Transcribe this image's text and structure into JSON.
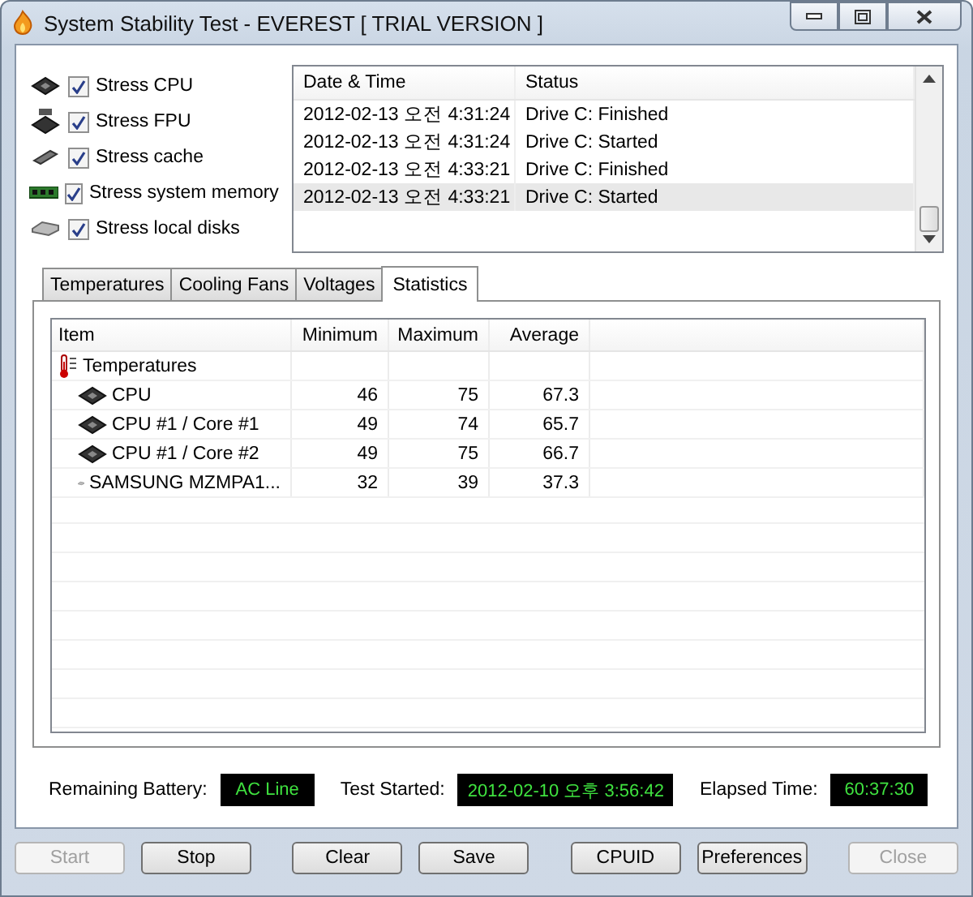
{
  "window": {
    "title": "System Stability Test - EVEREST  [ TRIAL VERSION ]"
  },
  "stress_options": [
    {
      "label": "Stress CPU",
      "checked": true,
      "kind": "cpu"
    },
    {
      "label": "Stress FPU",
      "checked": true,
      "kind": "fpu"
    },
    {
      "label": "Stress cache",
      "checked": true,
      "kind": "cache"
    },
    {
      "label": "Stress system memory",
      "checked": true,
      "kind": "memory"
    },
    {
      "label": "Stress local disks",
      "checked": true,
      "kind": "disk"
    }
  ],
  "log": {
    "columns": [
      "Date & Time",
      "Status"
    ],
    "rows": [
      {
        "date_time": "2012-02-13 오전 4:31:24",
        "status": "Drive C: Finished",
        "selected": false
      },
      {
        "date_time": "2012-02-13 오전 4:31:24",
        "status": "Drive C: Started",
        "selected": false
      },
      {
        "date_time": "2012-02-13 오전 4:33:21",
        "status": "Drive C: Finished",
        "selected": false
      },
      {
        "date_time": "2012-02-13 오전 4:33:21",
        "status": "Drive C: Started",
        "selected": true
      }
    ]
  },
  "tabs": [
    {
      "label": "Temperatures",
      "selected": false
    },
    {
      "label": "Cooling Fans",
      "selected": false
    },
    {
      "label": "Voltages",
      "selected": false
    },
    {
      "label": "Statistics",
      "selected": true
    }
  ],
  "statistics": {
    "columns": [
      "Item",
      "Minimum",
      "Maximum",
      "Average"
    ],
    "rows": [
      {
        "item": "Temperatures",
        "kind": "temperature",
        "children": [
          {
            "item": "CPU",
            "kind": "cpu",
            "minimum": "46",
            "maximum": "75",
            "average": "67.3"
          },
          {
            "item": "CPU #1 / Core #1",
            "kind": "cpu",
            "minimum": "49",
            "maximum": "74",
            "average": "65.7"
          },
          {
            "item": "CPU #1 / Core #2",
            "kind": "cpu",
            "minimum": "49",
            "maximum": "75",
            "average": "66.7"
          },
          {
            "item": "SAMSUNG MZMPA1...",
            "kind": "disk",
            "minimum": "32",
            "maximum": "39",
            "average": "37.3"
          }
        ]
      }
    ]
  },
  "info": [
    {
      "label": "Remaining Battery:",
      "value": "AC Line"
    },
    {
      "label": "Test Started:",
      "value": "2012-02-10 오후 3:56:42"
    },
    {
      "label": "Elapsed Time:",
      "value": "60:37:30"
    }
  ],
  "buttons": [
    {
      "label": "Start",
      "disabled": true
    },
    {
      "label": "Stop",
      "disabled": false
    },
    {
      "label": "Clear",
      "disabled": false
    },
    {
      "label": "Save",
      "disabled": false
    },
    {
      "label": "CPUID",
      "disabled": false
    },
    {
      "label": "Preferences",
      "disabled": false
    },
    {
      "label": "Close",
      "disabled": true
    }
  ]
}
